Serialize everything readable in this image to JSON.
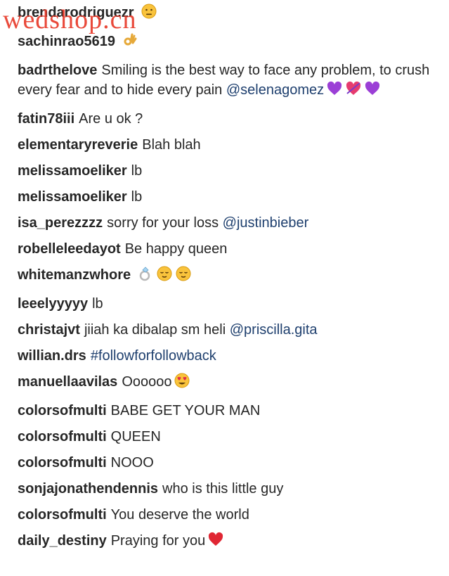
{
  "watermark": "wedshop.cn",
  "comments": [
    {
      "user": "brendarodriguezr",
      "text": "",
      "mention": "",
      "emoji": [
        "neutral-face-icon"
      ]
    },
    {
      "user": "sachinrao5619",
      "text": "",
      "mention": "",
      "emoji": [
        "ok-hand-icon"
      ]
    },
    {
      "user": "badrthelove",
      "text": "Smiling is the best way to face any problem, to crush every fear and to hide every pain",
      "mention": "@selenagomez",
      "emoji": [
        "purple-heart-icon",
        "heart-arrow-icon",
        "purple-heart-icon"
      ]
    },
    {
      "user": "fatin78iii",
      "text": "Are u ok ?",
      "mention": "",
      "emoji": []
    },
    {
      "user": "elementaryreverie",
      "text": "Blah blah",
      "mention": "",
      "emoji": []
    },
    {
      "user": "melissamoeliker",
      "text": "lb",
      "mention": "",
      "emoji": []
    },
    {
      "user": "melissamoeliker",
      "text": "lb",
      "mention": "",
      "emoji": []
    },
    {
      "user": "isa_perezzzz",
      "text": "sorry for your loss",
      "mention": "@justinbieber",
      "emoji": []
    },
    {
      "user": "robelleleedayot",
      "text": "Be happy queen",
      "mention": "",
      "emoji": []
    },
    {
      "user": "whitemanzwhore",
      "text": "",
      "mention": "",
      "emoji": [
        "ring-icon",
        "relieved-face-icon",
        "relieved-face-icon"
      ]
    },
    {
      "user": "leeelyyyyy",
      "text": "lb",
      "mention": "",
      "emoji": []
    },
    {
      "user": "christajvt",
      "text": "jiiah ka dibalap sm heli",
      "mention": "@priscilla.gita",
      "emoji": []
    },
    {
      "user": "willian.drs",
      "text": "",
      "mention": "#followforfollowback",
      "emoji": []
    },
    {
      "user": "manuellaavilas",
      "text": "Oooooo",
      "mention": "",
      "emoji": [
        "heart-eyes-icon"
      ]
    },
    {
      "user": "colorsofmulti",
      "text": "BABE GET YOUR MAN",
      "mention": "",
      "emoji": []
    },
    {
      "user": "colorsofmulti",
      "text": "QUEEN",
      "mention": "",
      "emoji": []
    },
    {
      "user": "colorsofmulti",
      "text": "NOOO",
      "mention": "",
      "emoji": []
    },
    {
      "user": "sonjajonathendennis",
      "text": "who is this little guy",
      "mention": "",
      "emoji": []
    },
    {
      "user": "colorsofmulti",
      "text": "You deserve the world",
      "mention": "",
      "emoji": []
    },
    {
      "user": "daily_destiny",
      "text": "Praying for you",
      "mention": "",
      "emoji": [
        "red-heart-icon"
      ]
    }
  ],
  "colors": {
    "username": "#262626",
    "mention": "#1e3f6e",
    "watermark": "#e83a2a"
  }
}
